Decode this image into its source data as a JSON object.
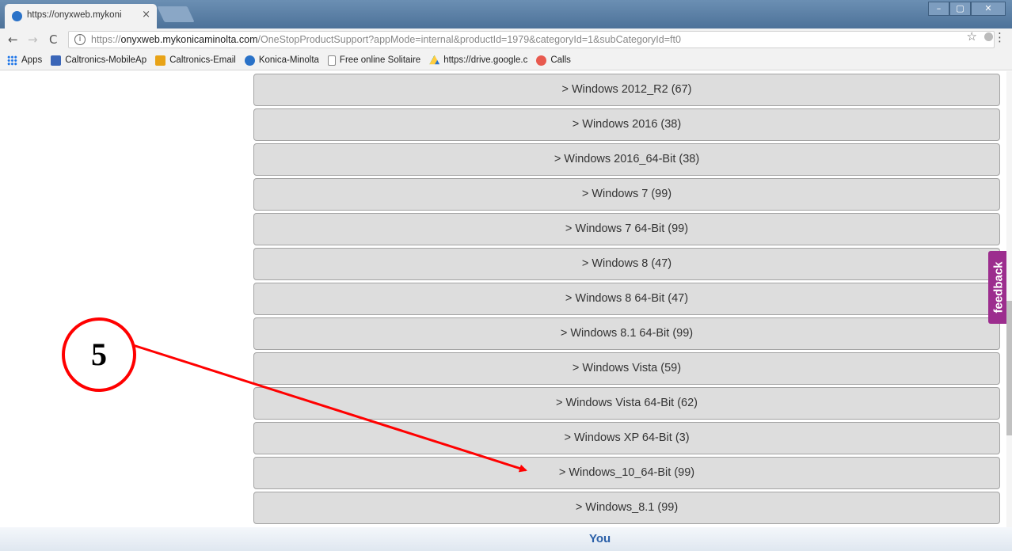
{
  "browser": {
    "tab": {
      "title": "https://onyxweb.mykoni",
      "close_glyph": "×"
    },
    "window_controls": [
      "–",
      "▢",
      "✕"
    ],
    "nav": {
      "back": "←",
      "forward": "→",
      "reload": "C"
    },
    "address": {
      "info_glyph": "i",
      "url_prefix": "https://",
      "url_host": "onyxweb.mykonicaminolta.com",
      "url_path": "/OneStopProductSupport?appMode=internal&productId=1979&categoryId=1&subCategoryId=ft0"
    },
    "star_glyph": "☆",
    "menu_glyph": "⋮",
    "bookmarks": [
      {
        "label": "Apps",
        "icon": "apps-grid-icon"
      },
      {
        "label": "Caltronics-MobileAp",
        "icon": "mobile-app-icon"
      },
      {
        "label": "Caltronics-Email",
        "icon": "email-icon"
      },
      {
        "label": "Konica-Minolta",
        "icon": "konica-logo-icon"
      },
      {
        "label": "Free online Solitaire",
        "icon": "page-icon"
      },
      {
        "label": "https://drive.google.c",
        "icon": "drive-icon"
      },
      {
        "label": "Calls",
        "icon": "calls-icon"
      }
    ]
  },
  "os_list": [
    "> Windows 2012_R2 (67)",
    "> Windows 2016 (38)",
    "> Windows 2016_64-Bit (38)",
    "> Windows 7 (99)",
    "> Windows 7 64-Bit (99)",
    "> Windows 8 (47)",
    "> Windows 8 64-Bit (47)",
    "> Windows 8.1 64-Bit (99)",
    "> Windows Vista (59)",
    "> Windows Vista 64-Bit (62)",
    "> Windows XP 64-Bit (3)",
    "> Windows_10_64-Bit (99)",
    "> Windows_8.1 (99)"
  ],
  "feedback": {
    "label": "feedback",
    "color": "#9c2d8e"
  },
  "annotation": {
    "number": "5",
    "color": "#ff0000"
  },
  "footer": {
    "partial_text": "You"
  }
}
